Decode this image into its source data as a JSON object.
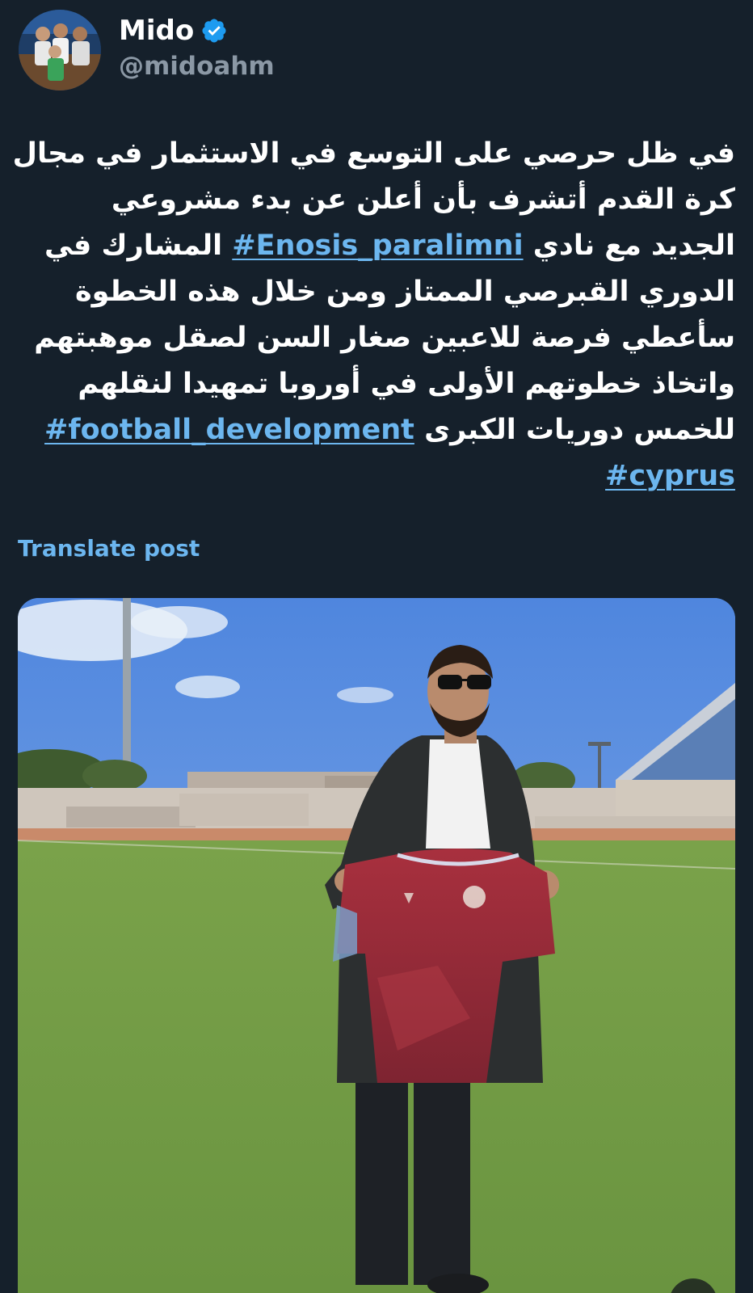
{
  "author": {
    "display_name": "Mido",
    "handle": "@midoahm",
    "verified": true,
    "avatar_icon": "avatar-photo",
    "verified_icon": "verified-badge-icon"
  },
  "tweet": {
    "lines": [
      {
        "text": "في ظل حرصي على التوسع في الاستثمار في مجال"
      },
      {
        "text": "كرة القدم أتشرف بأن أعلن عن بدء مشروعي"
      },
      {
        "before": "الجديد مع نادي",
        "hashtag": "#Enosis_paralimni",
        "after": "المشارك في"
      },
      {
        "text": "الدوري القبرصي الممتاز ومن خلال هذه الخطوة"
      },
      {
        "text": "سأعطي فرصة للاعبين صغار السن لصقل موهبتهم"
      },
      {
        "text": "واتخاذ خطوتهم الأولى في أوروبا تمهيدا لنقلهم"
      },
      {
        "before": "للخمس دوريات الكبرى",
        "hashtag": "#football_development"
      },
      {
        "hashtag": "#cyprus"
      }
    ]
  },
  "translate_label": "Translate post",
  "media": {
    "type": "video",
    "mute_icon": "speaker-muted-icon"
  },
  "colors": {
    "background": "#15202b",
    "link": "#6cb6ef",
    "handle": "#8b98a5",
    "text": "#ffffff"
  }
}
